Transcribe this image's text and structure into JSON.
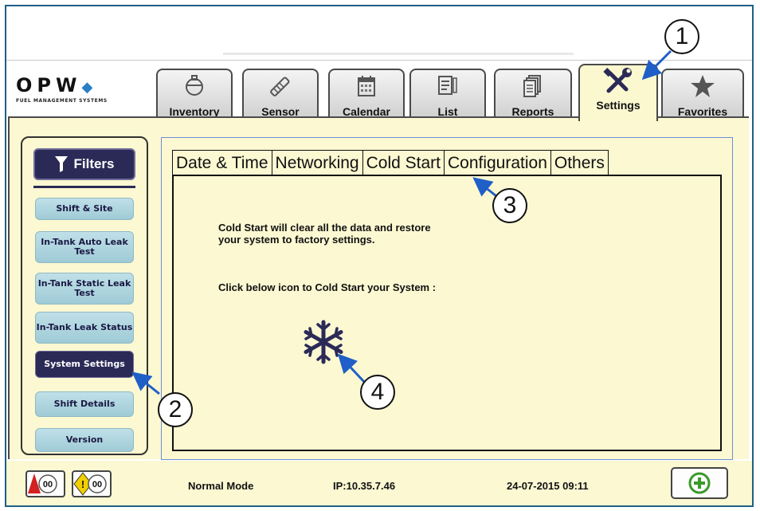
{
  "logo": {
    "name": "OPW",
    "diamond": "◆",
    "tagline": "FUEL MANAGEMENT SYSTEMS"
  },
  "main_tabs": [
    {
      "label": "Inventory",
      "icon": "tank-icon"
    },
    {
      "label": "Sensor",
      "icon": "sensor-probe-icon"
    },
    {
      "label": "Calendar",
      "icon": "calendar-icon"
    },
    {
      "label": "List",
      "icon": "list-icon"
    },
    {
      "label": "Reports",
      "icon": "reports-icon"
    },
    {
      "label": "Settings",
      "icon": "tools-icon",
      "active": true
    },
    {
      "label": "Favorites",
      "icon": "star-icon"
    }
  ],
  "sidebar": {
    "filters_label": "Filters",
    "items": [
      {
        "label": "Shift & Site"
      },
      {
        "label": "In-Tank Auto Leak Test"
      },
      {
        "label": "In-Tank Static Leak Test"
      },
      {
        "label": "In-Tank Leak Status"
      },
      {
        "label": "System Settings",
        "selected": true
      },
      {
        "label": "Shift Details"
      },
      {
        "label": "Version"
      }
    ]
  },
  "sub_tabs": [
    {
      "label": "Date & Time"
    },
    {
      "label": "Networking"
    },
    {
      "label": "Cold Start",
      "active": true
    },
    {
      "label": "Configuration"
    },
    {
      "label": "Others"
    }
  ],
  "cold_start": {
    "message_line1": "Cold Start will clear all the data and restore",
    "message_line2": "your system to factory settings.",
    "instruction": "Click below icon to Cold Start your System :"
  },
  "status_bar": {
    "alarm_count": "00",
    "warning_count": "00",
    "mode": "Normal Mode",
    "ip": "IP:10.35.7.46",
    "datetime": "24-07-2015 09:11"
  },
  "callouts": [
    "1",
    "2",
    "3",
    "4"
  ],
  "colors": {
    "panel_bg": "#fbf8d2",
    "nav_selected": "#2b2a57",
    "nav_button": "#a9d3dd",
    "accent_blue": "#1f5fc7",
    "add_green": "#3a9a2a",
    "alarm_red": "#d32020",
    "warning_yellow": "#f2d000"
  }
}
